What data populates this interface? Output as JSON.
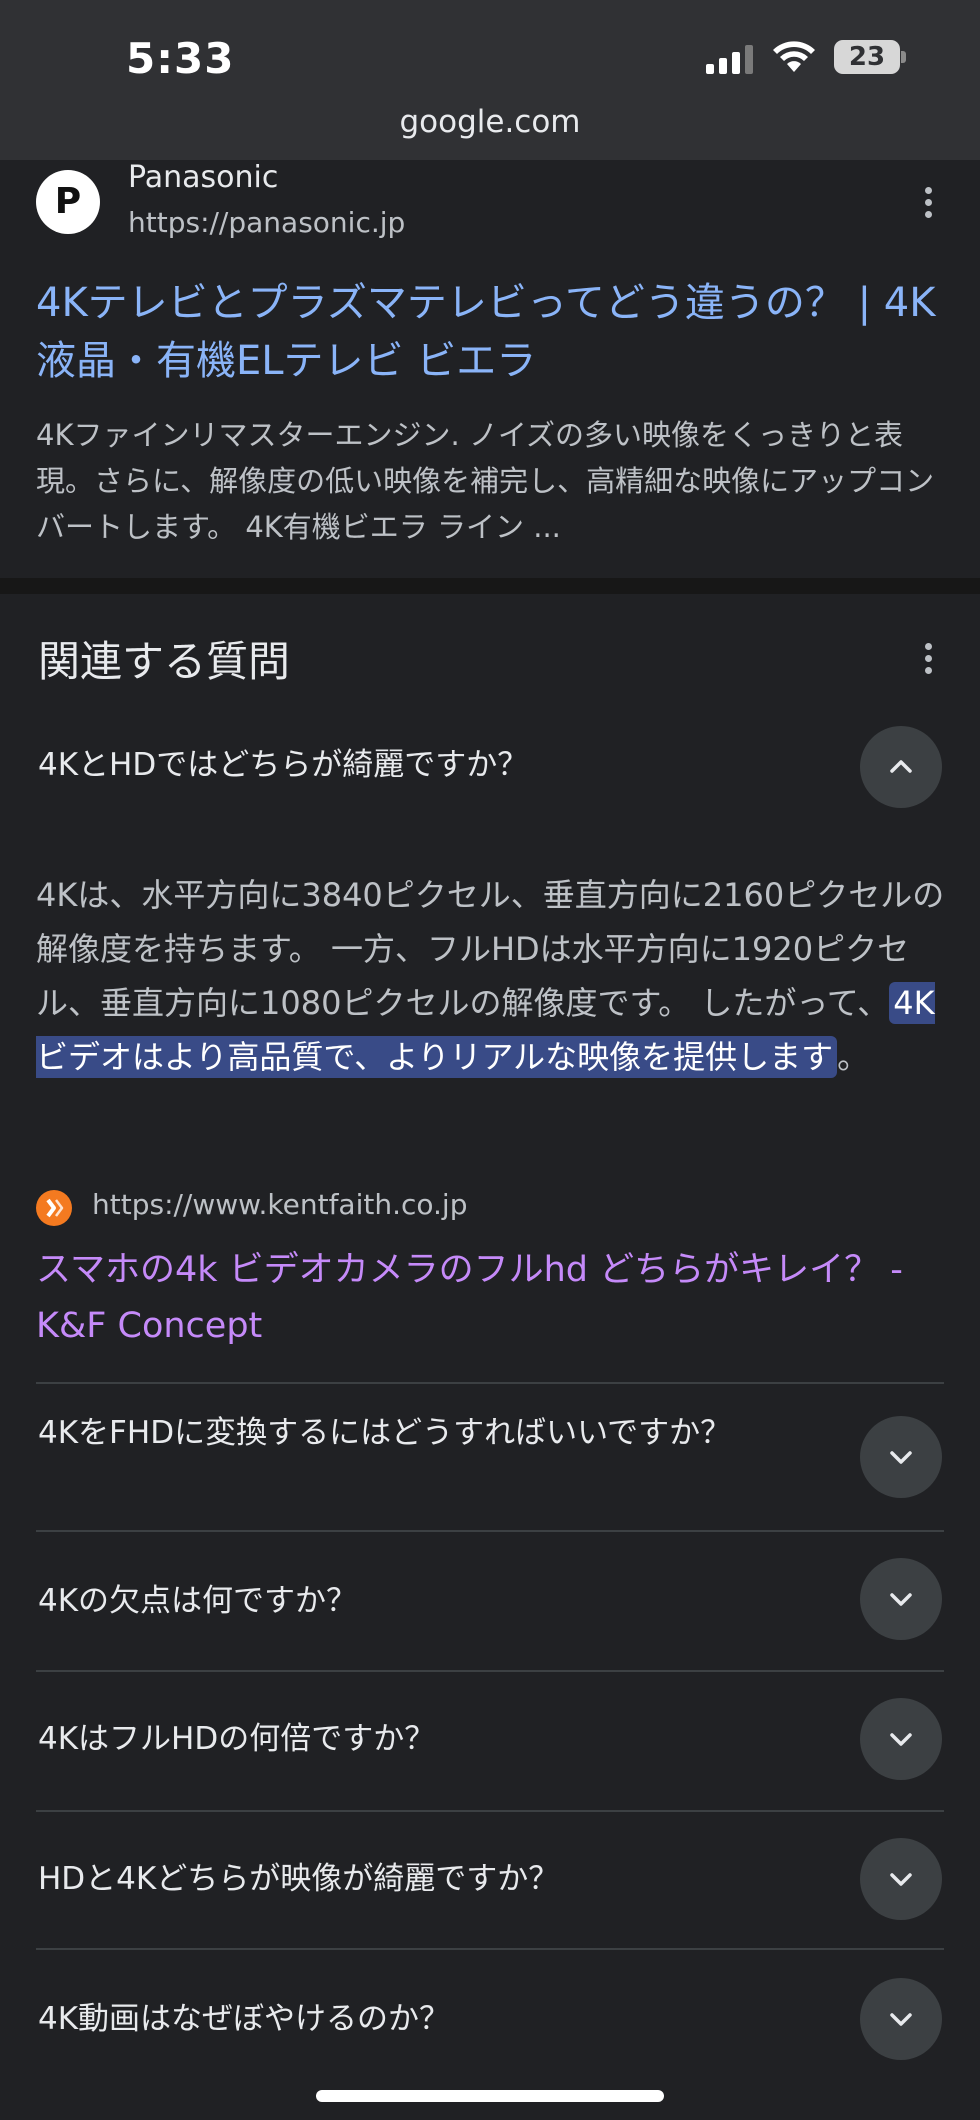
{
  "status_bar": {
    "time": "5:33",
    "battery": "23",
    "url": "google.com"
  },
  "result": {
    "favicon_letter": "P",
    "site_name": "Panasonic",
    "site_url": "https://panasonic.jp",
    "title": "4Kテレビとプラズマテレビってどう違うの？ | 4K液晶・有機ELテレビ ビエラ",
    "snippet": "4Kファインリマスターエンジン. ノイズの多い映像をくっきりと表現。さらに、解像度の低い映像を補完し、高精細な映像にアップコンバートします。 4K有機ビエラ ライン ..."
  },
  "paa": {
    "heading": "関連する質問",
    "expanded": {
      "question": "4KとHDではどちらが綺麗ですか？",
      "answer_pre": "4Kは、水平方向に3840ピクセル、垂直方向に2160ピクセルの解像度を持ちます。 一方、フルHDは水平方向に1920ピクセル、垂直方向に1080ピクセルの解像度です。 したがって、",
      "answer_highlight": "4Kビデオはより高品質で、よりリアルな映像を提供します",
      "answer_post": "。",
      "source_url": "https://www.kentfaith.co.jp",
      "source_title": "スマホの4k ビデオカメラのフルhd どちらがキレイ？ - K&F Concept"
    },
    "questions": [
      "4KをFHDに変換するにはどうすればいいですか？",
      "4Kの欠点は何ですか？",
      "4KはフルHDの何倍ですか？",
      "HDと4Kどちらが映像が綺麗ですか？",
      "4K動画はなぜぼやけるのか？"
    ]
  },
  "colors": {
    "background": "#202124",
    "link": "#8ab4f8",
    "visited_link": "#c58af9",
    "highlight": "#394b87"
  }
}
